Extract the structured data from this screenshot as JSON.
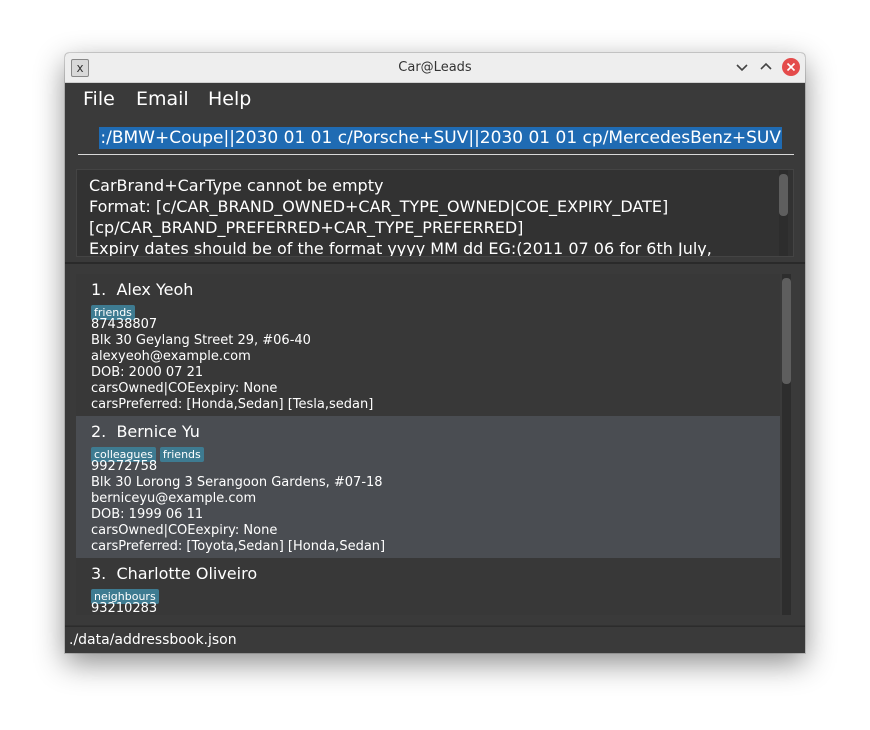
{
  "window": {
    "title": "Car@Leads"
  },
  "menu": [
    "File",
    "Email",
    "Help"
  ],
  "command": {
    "text": ":/BMW+Coupe||2030 01 01 c/Porsche+SUV||2030 01 01 cp/MercedesBenz+SUV"
  },
  "result": {
    "lines": [
      "CarBrand+CarType cannot be empty",
      "Format: [c/CAR_BRAND_OWNED+CAR_TYPE_OWNED|COE_EXPIRY_DATE]",
      "[cp/CAR_BRAND_PREFERRED+CAR_TYPE_PREFERRED]",
      "Expiry dates should be of the format yyyy MM dd EG:(2011 07 06 for 6th July,"
    ]
  },
  "persons": [
    {
      "index": "1.",
      "name": "Alex Yeoh",
      "tags": [
        "friends"
      ],
      "phone": "87438807",
      "address": "Blk 30 Geylang Street 29, #06-40",
      "email": "alexyeoh@example.com",
      "dob": "DOB: 2000 07 21",
      "cars_owned": "carsOwned|COEexpiry: None",
      "cars_preferred": "carsPreferred: [Honda,Sedan] [Tesla,sedan]"
    },
    {
      "index": "2.",
      "name": "Bernice Yu",
      "tags": [
        "colleagues",
        "friends"
      ],
      "phone": "99272758",
      "address": "Blk 30 Lorong 3 Serangoon Gardens, #07-18",
      "email": "berniceyu@example.com",
      "dob": "DOB: 1999 06 11",
      "cars_owned": "carsOwned|COEexpiry: None",
      "cars_preferred": "carsPreferred: [Toyota,Sedan] [Honda,Sedan]"
    },
    {
      "index": "3.",
      "name": "Charlotte Oliveiro",
      "tags": [
        "neighbours"
      ],
      "phone": "93210283"
    }
  ],
  "status": {
    "path": "./data/addressbook.json"
  },
  "colors": {
    "window_bg": "#323232",
    "selection": "#1f6bb3",
    "tag_bg": "#3e7b91",
    "close_button": "#e44b4b"
  }
}
